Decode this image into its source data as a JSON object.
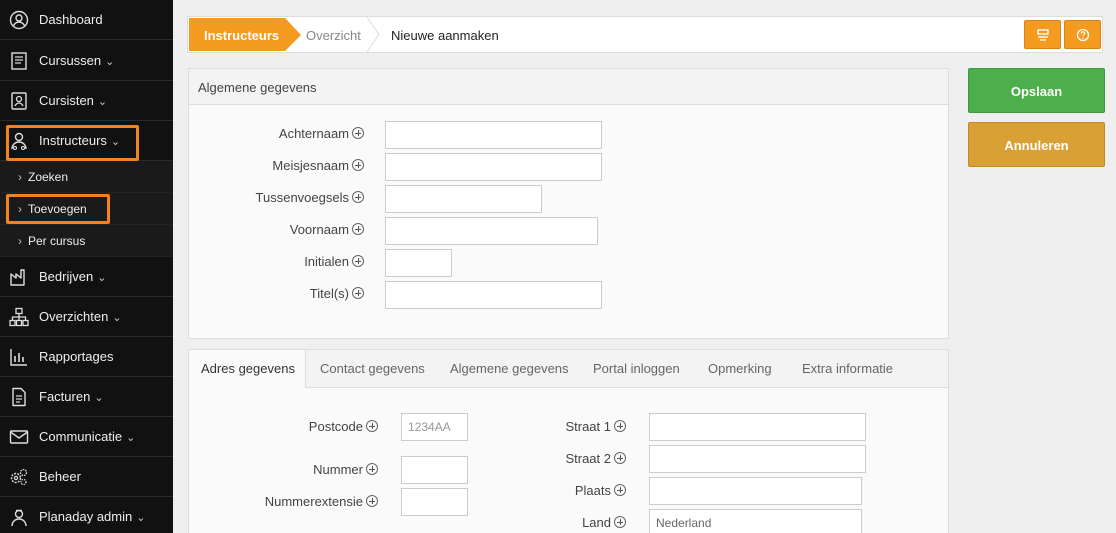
{
  "sidebar": {
    "items": [
      {
        "label": "Dashboard",
        "chevron": ""
      },
      {
        "label": "Cursussen",
        "chevron": "⌄"
      },
      {
        "label": "Cursisten",
        "chevron": "⌄"
      },
      {
        "label": "Instructeurs",
        "chevron": "⌄"
      },
      {
        "label": "Bedrijven",
        "chevron": "⌄"
      },
      {
        "label": "Overzichten",
        "chevron": "⌄"
      },
      {
        "label": "Rapportages",
        "chevron": ""
      },
      {
        "label": "Facturen",
        "chevron": "⌄"
      },
      {
        "label": "Communicatie",
        "chevron": "⌄"
      },
      {
        "label": "Beheer",
        "chevron": ""
      },
      {
        "label": "Planaday admin",
        "chevron": "⌄"
      }
    ],
    "subitems": [
      {
        "label": "Zoeken"
      },
      {
        "label": "Toevoegen"
      },
      {
        "label": "Per cursus"
      }
    ]
  },
  "breadcrumb": {
    "items": [
      "Instructeurs",
      "Overzicht",
      "Nieuwe aanmaken"
    ]
  },
  "general": {
    "title": "Algemene gegevens",
    "fields": [
      {
        "label": "Achternaam",
        "value": ""
      },
      {
        "label": "Meisjesnaam",
        "value": ""
      },
      {
        "label": "Tussenvoegsels",
        "value": ""
      },
      {
        "label": "Voornaam",
        "value": ""
      },
      {
        "label": "Initialen",
        "value": ""
      },
      {
        "label": "Titel(s)",
        "value": ""
      }
    ]
  },
  "tabs": [
    "Adres gegevens",
    "Contact gegevens",
    "Algemene gegevens",
    "Portal inloggen",
    "Opmerking",
    "Extra informatie"
  ],
  "address": {
    "postcode": {
      "label": "Postcode",
      "placeholder": "1234AA",
      "value": ""
    },
    "nummer": {
      "label": "Nummer",
      "value": ""
    },
    "nummerextensie": {
      "label": "Nummerextensie",
      "value": ""
    },
    "straat1": {
      "label": "Straat 1",
      "value": ""
    },
    "straat2": {
      "label": "Straat 2",
      "value": ""
    },
    "plaats": {
      "label": "Plaats",
      "value": ""
    },
    "land": {
      "label": "Land",
      "value": "Nederland"
    }
  },
  "actions": {
    "save_label": "Opslaan",
    "cancel_label": "Annuleren"
  },
  "colors": {
    "accent": "#f39a1f",
    "highlight": "#f58220",
    "save": "#4caf4c",
    "cancel": "#d9a035",
    "sidebar_bg": "#111111"
  }
}
